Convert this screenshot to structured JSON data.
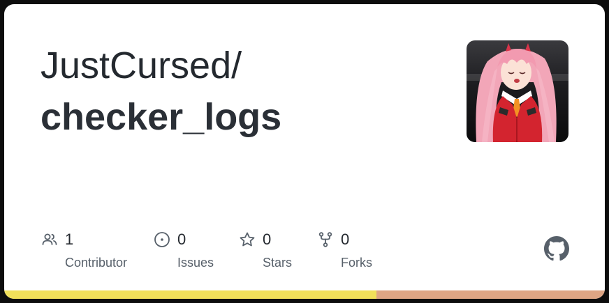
{
  "repo": {
    "owner_prefix": "JustCursed/",
    "name": "checker_logs"
  },
  "avatar": {
    "icon": "anime-character-avatar"
  },
  "stats": [
    {
      "icon": "people-icon",
      "value": "1",
      "label": "Contributor"
    },
    {
      "icon": "issue-opened-icon",
      "value": "0",
      "label": "Issues"
    },
    {
      "icon": "star-icon",
      "value": "0",
      "label": "Stars"
    },
    {
      "icon": "repo-forked-icon",
      "value": "0",
      "label": "Forks"
    }
  ],
  "brand": {
    "icon": "github-mark-icon"
  },
  "languages": [
    {
      "color": "#f1e05a",
      "share": 0.62
    },
    {
      "color": "#dea584",
      "share": 0.38
    }
  ],
  "colors": {
    "text_primary": "#24292f",
    "text_muted": "#57606a",
    "card_background": "#ffffff",
    "frame": "#0d0d0d"
  }
}
